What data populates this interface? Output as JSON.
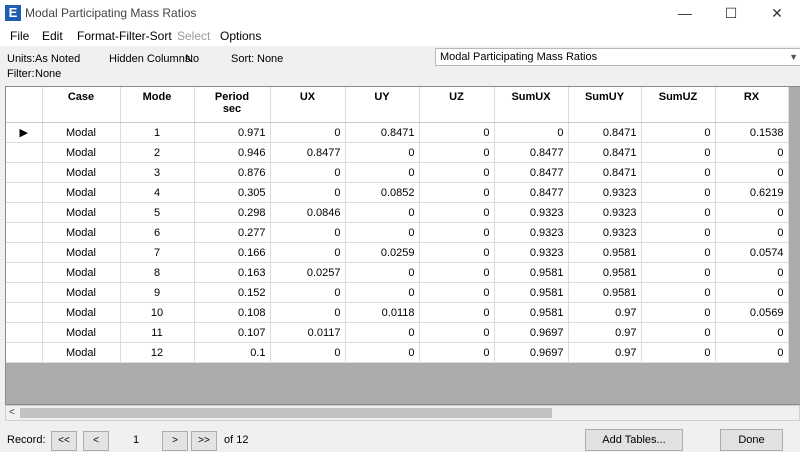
{
  "window": {
    "title": "Modal Participating Mass Ratios",
    "app_icon_letter": "E",
    "minimize": "—",
    "maximize": "☐",
    "close": "✕"
  },
  "menu": {
    "items": [
      "File",
      "Edit",
      "Format-Filter-Sort",
      "Select",
      "Options"
    ]
  },
  "info": {
    "units_label": "Units:",
    "units_value": "As Noted",
    "hidden_label": "Hidden Columns:",
    "hidden_value": "No",
    "sort_label": "Sort:",
    "sort_value": "None",
    "filter_label": "Filter:",
    "filter_value": "None",
    "table_selected": "Modal Participating Mass Ratios"
  },
  "columns": [
    {
      "line1": "Case",
      "line2": ""
    },
    {
      "line1": "Mode",
      "line2": ""
    },
    {
      "line1": "Period",
      "line2": "sec"
    },
    {
      "line1": "UX",
      "line2": ""
    },
    {
      "line1": "UY",
      "line2": ""
    },
    {
      "line1": "UZ",
      "line2": ""
    },
    {
      "line1": "SumUX",
      "line2": ""
    },
    {
      "line1": "SumUY",
      "line2": ""
    },
    {
      "line1": "SumUZ",
      "line2": ""
    },
    {
      "line1": "RX",
      "line2": ""
    }
  ],
  "rows": [
    [
      "Modal",
      "1",
      "0.971",
      "0",
      "0.8471",
      "0",
      "0",
      "0.8471",
      "0",
      "0.1538"
    ],
    [
      "Modal",
      "2",
      "0.946",
      "0.8477",
      "0",
      "0",
      "0.8477",
      "0.8471",
      "0",
      "0"
    ],
    [
      "Modal",
      "3",
      "0.876",
      "0",
      "0",
      "0",
      "0.8477",
      "0.8471",
      "0",
      "0"
    ],
    [
      "Modal",
      "4",
      "0.305",
      "0",
      "0.0852",
      "0",
      "0.8477",
      "0.9323",
      "0",
      "0.6219"
    ],
    [
      "Modal",
      "5",
      "0.298",
      "0.0846",
      "0",
      "0",
      "0.9323",
      "0.9323",
      "0",
      "0"
    ],
    [
      "Modal",
      "6",
      "0.277",
      "0",
      "0",
      "0",
      "0.9323",
      "0.9323",
      "0",
      "0"
    ],
    [
      "Modal",
      "7",
      "0.166",
      "0",
      "0.0259",
      "0",
      "0.9323",
      "0.9581",
      "0",
      "0.0574"
    ],
    [
      "Modal",
      "8",
      "0.163",
      "0.0257",
      "0",
      "0",
      "0.9581",
      "0.9581",
      "0",
      "0"
    ],
    [
      "Modal",
      "9",
      "0.152",
      "0",
      "0",
      "0",
      "0.9581",
      "0.9581",
      "0",
      "0"
    ],
    [
      "Modal",
      "10",
      "0.108",
      "0",
      "0.0118",
      "0",
      "0.9581",
      "0.97",
      "0",
      "0.0569"
    ],
    [
      "Modal",
      "11",
      "0.107",
      "0.0117",
      "0",
      "0",
      "0.9697",
      "0.97",
      "0",
      "0"
    ],
    [
      "Modal",
      "12",
      "0.1",
      "0",
      "0",
      "0",
      "0.9697",
      "0.97",
      "0",
      "0"
    ]
  ],
  "current_row_marker": "▶",
  "scroll_left_arrow": "<",
  "bottom": {
    "record_label": "Record:",
    "first": "<<",
    "prev": "<",
    "current": "1",
    "next": ">",
    "last": ">>",
    "of_label": "of 12",
    "add_tables": "Add Tables...",
    "done": "Done"
  }
}
